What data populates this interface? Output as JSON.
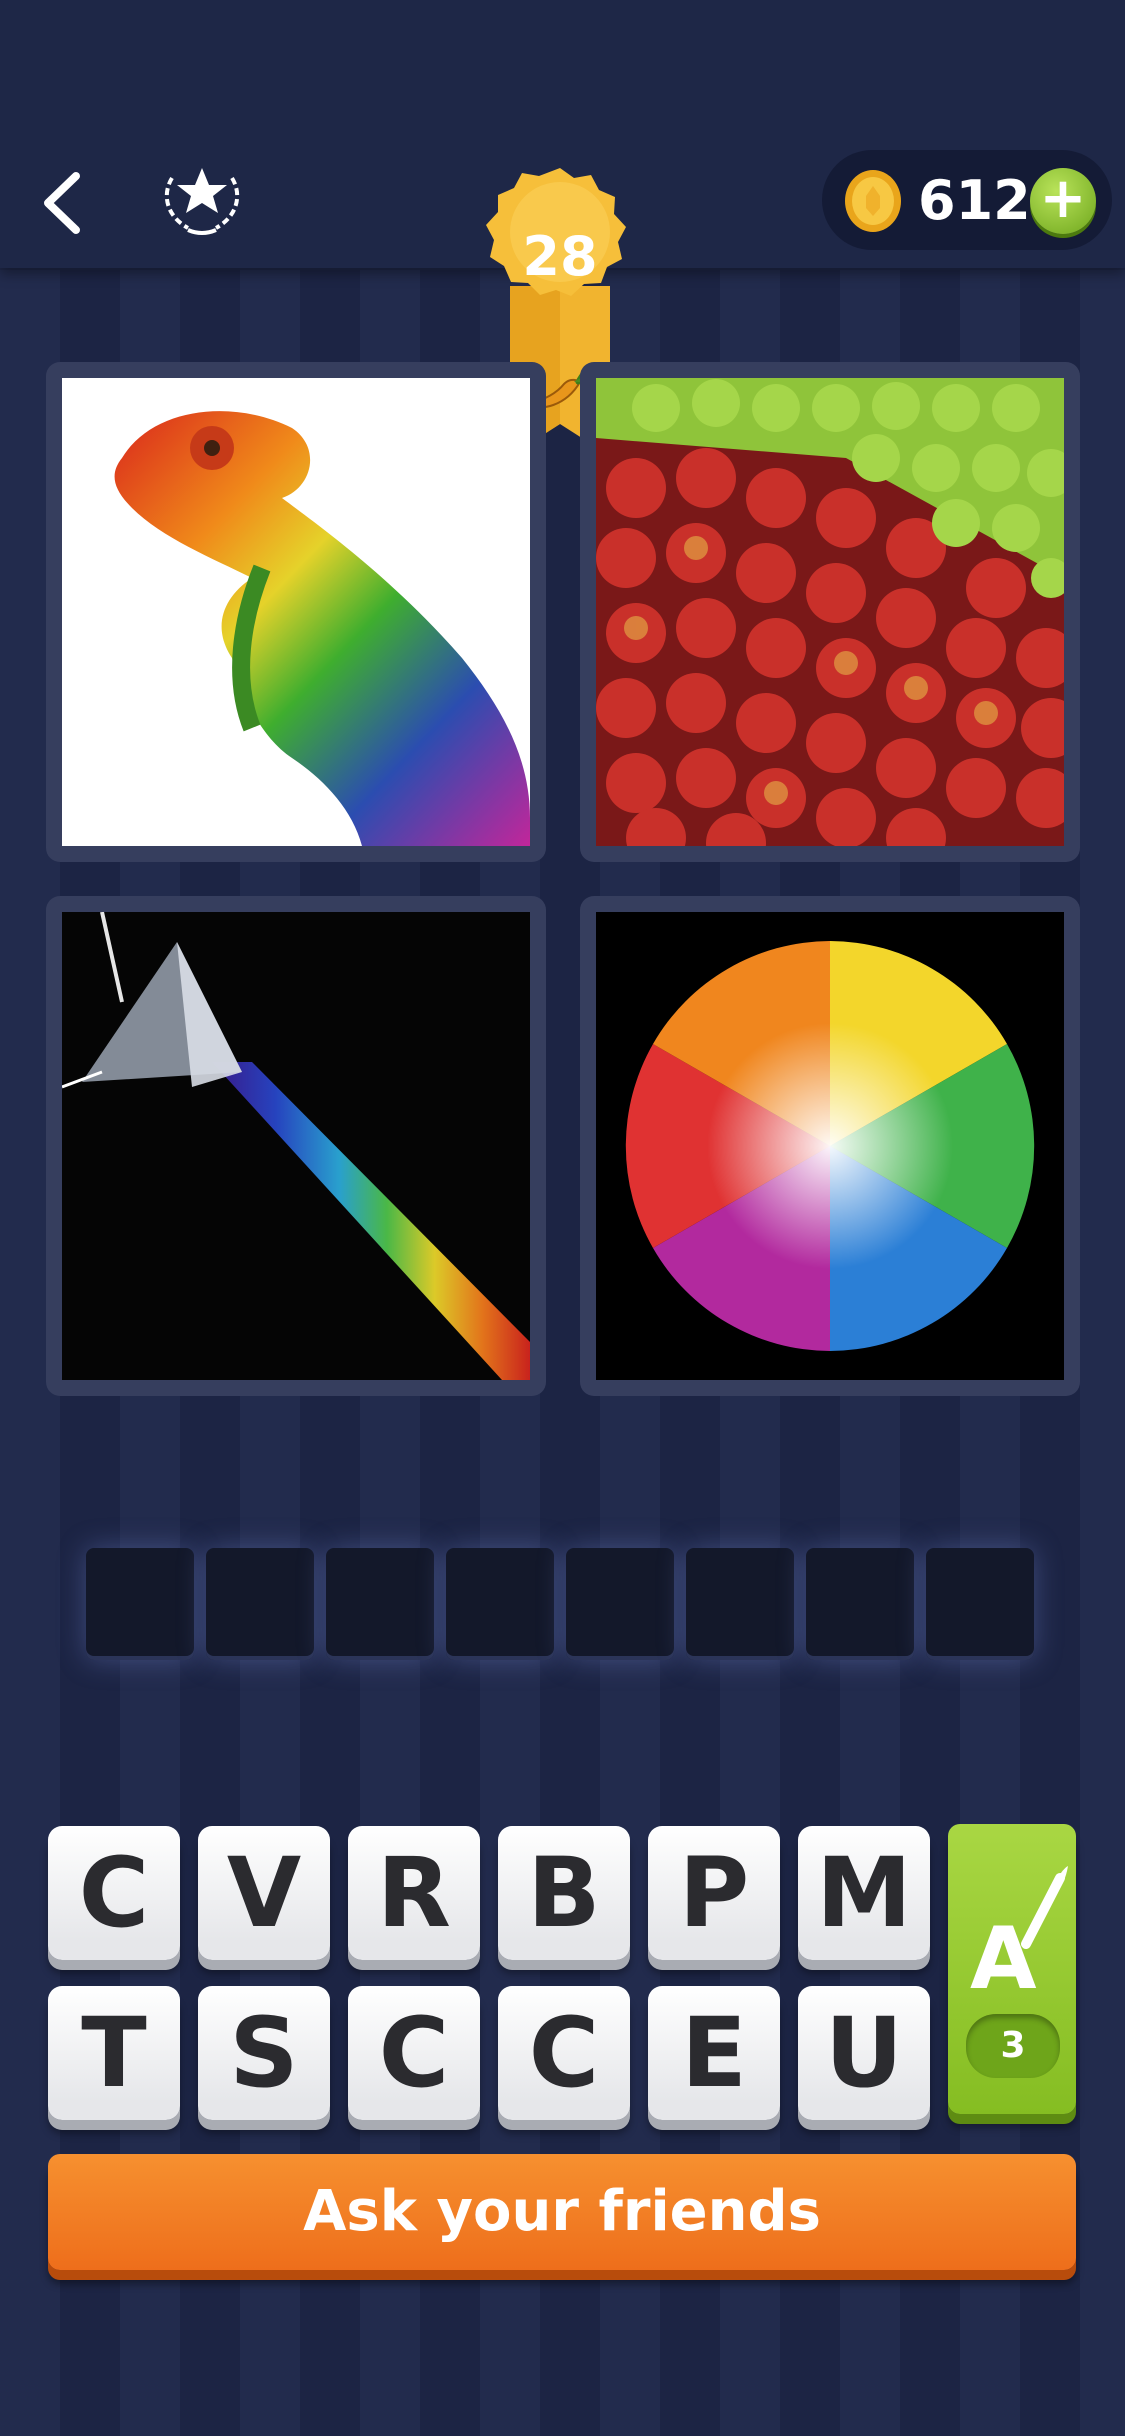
{
  "header": {
    "back_icon": "chevron-left-icon",
    "achievements_icon": "laurel-star-icon",
    "level": "28",
    "difficulty_icon": "chili-pepper-icon",
    "coins": "612",
    "coin_icon": "coin-icon",
    "add_coins_label": "+"
  },
  "puzzle": {
    "images": [
      {
        "subject": "rainbow-colored chameleon"
      },
      {
        "subject": "red and green apples"
      },
      {
        "subject": "prism splitting light into a rainbow"
      },
      {
        "subject": "color wheel flower"
      }
    ],
    "answer_slots": 8
  },
  "keyboard": {
    "row1": [
      "C",
      "V",
      "R",
      "B",
      "P",
      "M"
    ],
    "row2": [
      "T",
      "S",
      "C",
      "C",
      "E",
      "U"
    ]
  },
  "hint": {
    "icon": "brush-letter-a-icon",
    "count": "3"
  },
  "ask_button": {
    "label": "Ask your friends"
  },
  "colors": {
    "background": "#1f2748",
    "accent_orange": "#ee6e1b",
    "accent_green": "#85bd22",
    "badge_gold": "#f2b733"
  }
}
